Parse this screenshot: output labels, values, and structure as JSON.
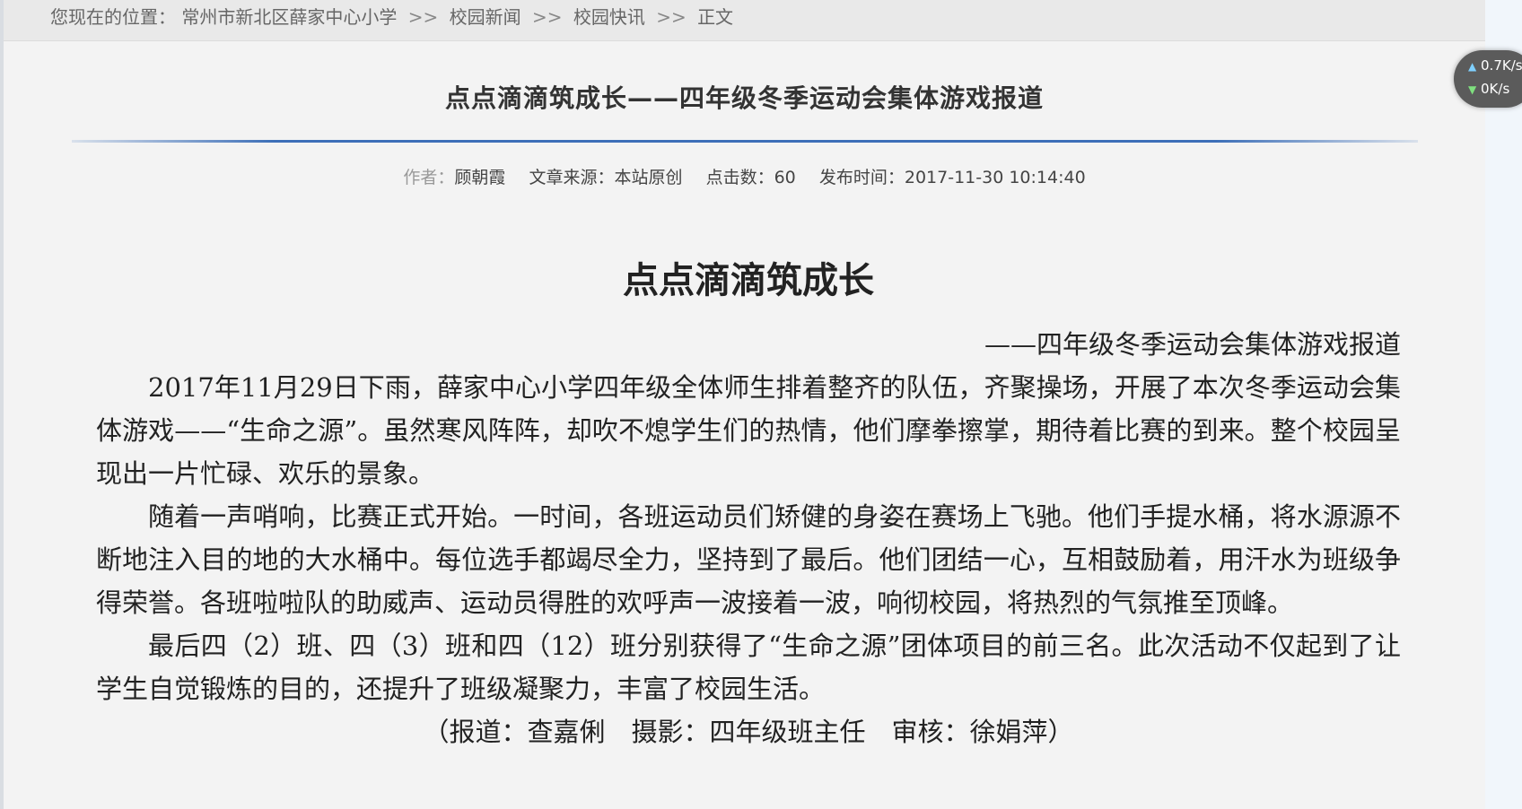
{
  "breadcrumb": {
    "prefix": "您现在的位置：",
    "items": [
      "常州市新北区薛家中心小学",
      "校园新闻",
      "校园快讯",
      "正文"
    ],
    "separator": ">>"
  },
  "article": {
    "title": "点点滴滴筑成长——四年级冬季运动会集体游戏报道",
    "meta": {
      "author_label": "作者：",
      "author": "顾朝霞",
      "source_label": "文章来源：",
      "source": "本站原创",
      "clicks_label": "点击数：",
      "clicks": "60",
      "published_label": "发布时间：",
      "published": "2017-11-30 10:14:40"
    },
    "body": {
      "heading": "点点滴滴筑成长",
      "subheading": "——四年级冬季运动会集体游戏报道",
      "paragraphs": [
        "2017年11月29日下雨，薛家中心小学四年级全体师生排着整齐的队伍，齐聚操场，开展了本次冬季运动会集体游戏——“生命之源”。虽然寒风阵阵，却吹不熄学生们的热情，他们摩拳擦掌，期待着比赛的到来。整个校园呈现出一片忙碌、欢乐的景象。",
        "随着一声哨响，比赛正式开始。一时间，各班运动员们矫健的身姿在赛场上飞驰。他们手提水桶，将水源源不断地注入目的地的大水桶中。每位选手都竭尽全力，坚持到了最后。他们团结一心，互相鼓励着，用汗水为班级争得荣誉。各班啦啦队的助威声、运动员得胜的欢呼声一波接着一波，响彻校园，将热烈的气氛推至顶峰。",
        "最后四（2）班、四（3）班和四（12）班分别获得了“生命之源”团体项目的前三名。此次活动不仅起到了让学生自觉锻炼的目的，还提升了班级凝聚力，丰富了校园生活。"
      ],
      "credit": "（报道：查嘉俐　摄影：四年级班主任　审核：徐娟萍）"
    }
  },
  "net_widget": {
    "upload": "0.7K/s",
    "download": "0K/s"
  }
}
